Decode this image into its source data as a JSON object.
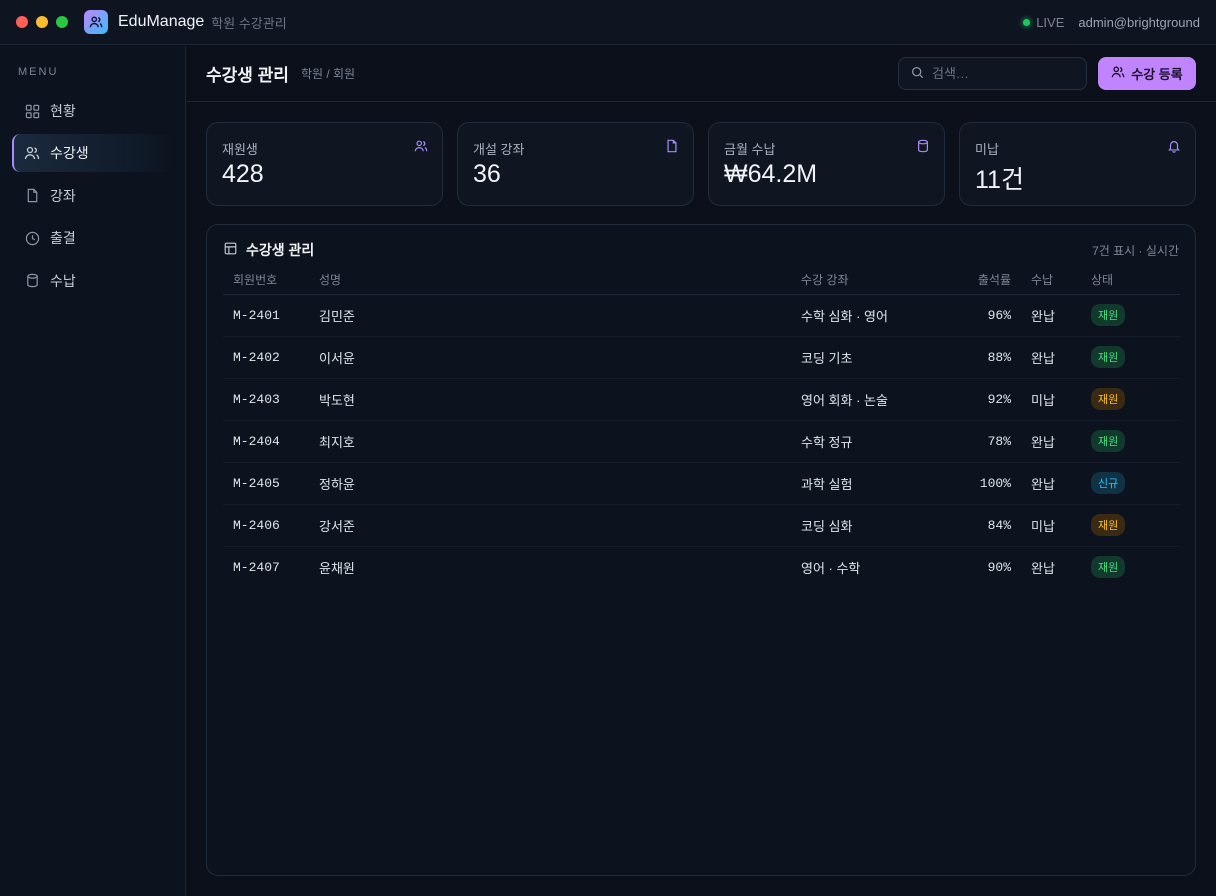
{
  "app": {
    "name": "EduManage",
    "subtitle": "학원 수강관리",
    "live": "LIVE",
    "user": "admin@brightground"
  },
  "sidebar": {
    "menu_label": "MENU",
    "items": [
      {
        "label": "현황",
        "icon": "grid-icon",
        "active": false
      },
      {
        "label": "수강생",
        "icon": "users-icon",
        "active": true
      },
      {
        "label": "강좌",
        "icon": "file-icon",
        "active": false
      },
      {
        "label": "출결",
        "icon": "clock-icon",
        "active": false
      },
      {
        "label": "수납",
        "icon": "database-icon",
        "active": false
      }
    ]
  },
  "header": {
    "title": "수강생 관리",
    "breadcrumb": "학원 / 회원",
    "search_placeholder": "검색…",
    "add_button": "수강 등록"
  },
  "stats": [
    {
      "label": "재원생",
      "value": "428",
      "icon": "users-icon"
    },
    {
      "label": "개설 강좌",
      "value": "36",
      "icon": "file-icon"
    },
    {
      "label": "금월 수납",
      "value": "₩64.2M",
      "icon": "database-icon"
    },
    {
      "label": "미납",
      "value": "11건",
      "icon": "bell-icon"
    }
  ],
  "table": {
    "title": "수강생 관리",
    "meta": "7건 표시 · 실시간",
    "columns": [
      "회원번호",
      "성명",
      "수강 강좌",
      "출석률",
      "수납",
      "상태"
    ],
    "rows": [
      {
        "id": "M-2401",
        "name": "김민준",
        "course": "수학 심화 · 영어",
        "rate": "96%",
        "pay": "완납",
        "status": "재원",
        "tone": "green"
      },
      {
        "id": "M-2402",
        "name": "이서윤",
        "course": "코딩 기초",
        "rate": "88%",
        "pay": "완납",
        "status": "재원",
        "tone": "green"
      },
      {
        "id": "M-2403",
        "name": "박도현",
        "course": "영어 회화 · 논술",
        "rate": "92%",
        "pay": "미납",
        "status": "재원",
        "tone": "orange"
      },
      {
        "id": "M-2404",
        "name": "최지호",
        "course": "수학 정규",
        "rate": "78%",
        "pay": "완납",
        "status": "재원",
        "tone": "green"
      },
      {
        "id": "M-2405",
        "name": "정하윤",
        "course": "과학 실험",
        "rate": "100%",
        "pay": "완납",
        "status": "신규",
        "tone": "blue"
      },
      {
        "id": "M-2406",
        "name": "강서준",
        "course": "코딩 심화",
        "rate": "84%",
        "pay": "미납",
        "status": "재원",
        "tone": "orange"
      },
      {
        "id": "M-2407",
        "name": "윤채원",
        "course": "영어 · 수학",
        "rate": "90%",
        "pay": "완납",
        "status": "재원",
        "tone": "green"
      }
    ]
  },
  "colors": {
    "accent": "#c084fc",
    "green_bg": "#123a2c",
    "green_fg": "#4ade80",
    "orange_bg": "#3a2a14",
    "orange_fg": "#fbbf24",
    "blue_bg": "#0f3244",
    "blue_fg": "#38bdf8"
  }
}
